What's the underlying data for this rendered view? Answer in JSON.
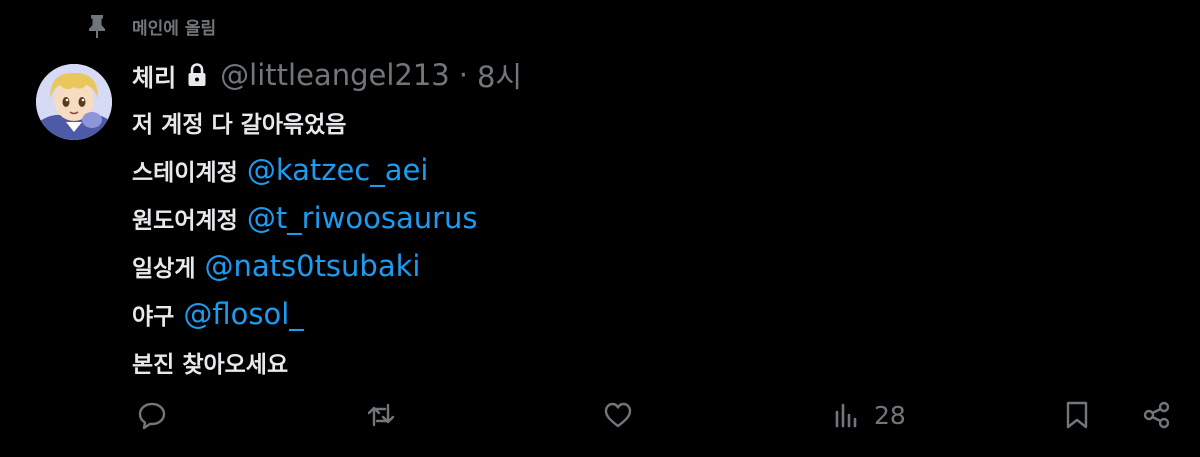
{
  "pinned": {
    "label": "메인에 올림",
    "icon": "pin-icon"
  },
  "tweet": {
    "author": {
      "display_name": "체리",
      "handle": "@littleangel213",
      "protected_icon": "lock-icon",
      "avatar": "avatar"
    },
    "separator": "·",
    "time": "8시",
    "lines": [
      {
        "text": "저 계정 다 갈아윾었음",
        "mention": ""
      },
      {
        "text": "스테이계정",
        "mention": "@katzec_aei"
      },
      {
        "text": "원도어계정",
        "mention": "@t_riwoosaurus"
      },
      {
        "text": "일상게",
        "mention": "@nats0tsubaki"
      },
      {
        "text": "야구",
        "mention": "@flosol_"
      },
      {
        "text": "본진 찾아오세요",
        "mention": ""
      }
    ]
  },
  "actions": {
    "reply_icon": "reply-icon",
    "retweet_icon": "retweet-icon",
    "like_icon": "heart-icon",
    "views_icon": "views-icon",
    "views_count": "28",
    "bookmark_icon": "bookmark-icon",
    "share_icon": "share-icon"
  },
  "colors": {
    "background": "#000000",
    "primary_text": "#e7e9ea",
    "secondary_text": "#71767b",
    "link": "#1d9bf0"
  }
}
